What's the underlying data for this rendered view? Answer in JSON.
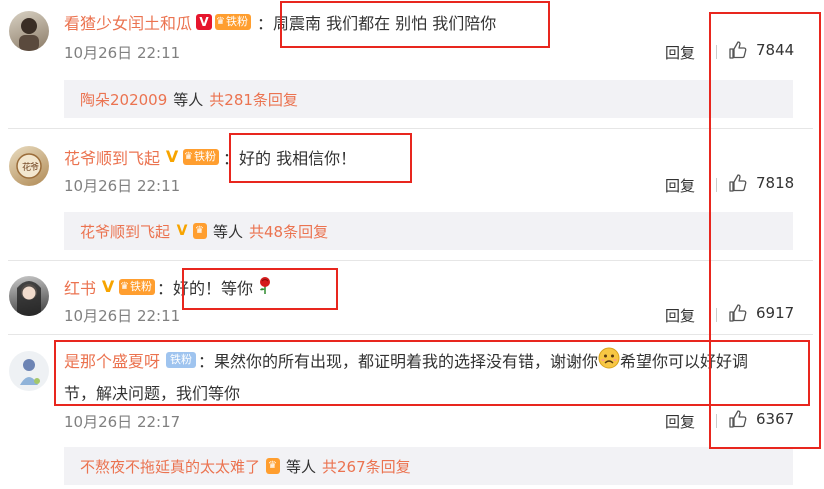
{
  "comments": [
    {
      "username": "看猹少女闰土和瓜",
      "text": "：周震南 我们都在 别怕 我们陪你",
      "time": "10月26日 22:11",
      "reply_label": "回复",
      "likes": "7844",
      "fan_label": "铁粉",
      "sub": {
        "name": "陶朵202009",
        "etc": "等人",
        "count": "共281条回复"
      }
    },
    {
      "username": "花爷顺到飞起",
      "text": "：好的 我相信你！",
      "time": "10月26日 22:11",
      "reply_label": "回复",
      "likes": "7818",
      "fan_label": "铁粉",
      "sub": {
        "name": "花爷顺到飞起",
        "etc": "等人",
        "count": "共48条回复"
      }
    },
    {
      "username": "红书",
      "text": "：好的！等你",
      "time": "10月26日 22:11",
      "reply_label": "回复",
      "likes": "6917",
      "fan_label": "铁粉"
    },
    {
      "username": "是那个盛夏呀",
      "text_part1": "：果然你的所有出现，都证明着我的选择没有错，谢谢你",
      "text_part2": "希望你可以好好调",
      "text_line2": "节，解决问题，我们等你",
      "time": "10月26日 22:17",
      "reply_label": "回复",
      "likes": "6367",
      "fan_label": "铁粉",
      "sub": {
        "name": "不熬夜不拖延真的太太难了",
        "etc": "等人",
        "count": "共267条回复"
      }
    }
  ],
  "colors": {
    "username": "#eb7350",
    "highlight": "#e8261e",
    "subbox_bg": "#f2f2f5"
  },
  "icons": [
    "thumbs-up-icon",
    "rose-icon",
    "sad-face-icon",
    "v-verified-icon",
    "crown-icon"
  ]
}
